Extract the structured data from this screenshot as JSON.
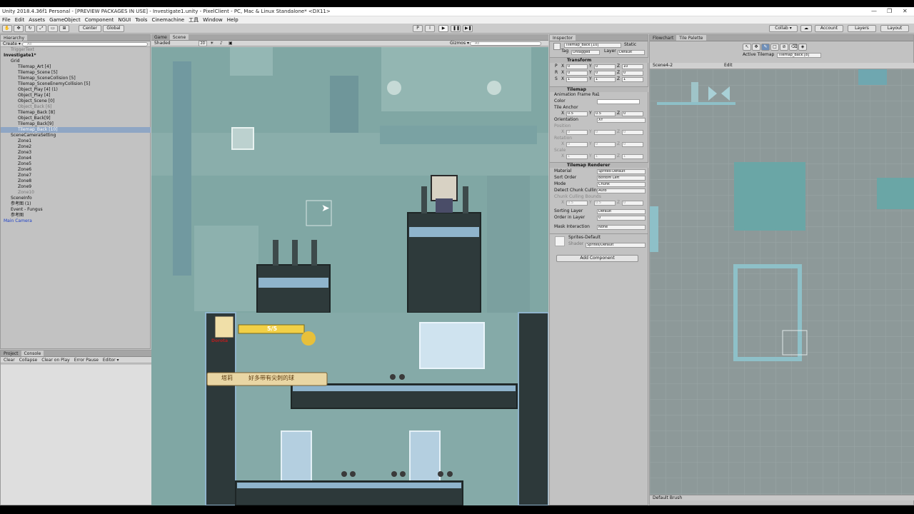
{
  "window": {
    "title": "Unity 2018.4.36f1 Personal - [PREVIEW PACKAGES IN USE] - Investigate1.unity - PixelClient - PC, Mac & Linux Standalone* <DX11>",
    "controls": [
      "—",
      "❐",
      "✕"
    ]
  },
  "menu": [
    "File",
    "Edit",
    "Assets",
    "GameObject",
    "Component",
    "NGUI",
    "Tools",
    "Cinemachine",
    "工具",
    "Window",
    "Help"
  ],
  "toolbar": {
    "pivot": "Center",
    "space": "Global",
    "collab": "Collab ▾",
    "account": "Account",
    "layers": "Layers",
    "layout": "Layout"
  },
  "hierarchy": {
    "tab": "Hierarchy",
    "create": "Create ▾",
    "search_placeholder": "All",
    "rows": [
      {
        "label": "TriggerText",
        "indent": 1,
        "dim": true
      },
      {
        "label": "Investigate1*",
        "indent": 0,
        "bold": true
      },
      {
        "label": "Grid",
        "indent": 1
      },
      {
        "label": "Tilemap_Art [4]",
        "indent": 2
      },
      {
        "label": "Tilemap_Scene [5]",
        "indent": 2
      },
      {
        "label": "Tilemap_SceneCollision [5]",
        "indent": 2
      },
      {
        "label": "Tilemap_SceneEnemyCollision [5]",
        "indent": 2
      },
      {
        "label": "Object_Play [4] (1)",
        "indent": 2
      },
      {
        "label": "Object_Play [4]",
        "indent": 2
      },
      {
        "label": "Object_Scene [0]",
        "indent": 2
      },
      {
        "label": "Object_Back [6]",
        "indent": 2,
        "dim": true
      },
      {
        "label": "Tilemap_Back [8]",
        "indent": 2
      },
      {
        "label": "Object_Back[9]",
        "indent": 2
      },
      {
        "label": "Tilemap_Back[9]",
        "indent": 2
      },
      {
        "label": "Tilemap_Back [10]",
        "indent": 2,
        "selected": true
      },
      {
        "label": "SceneCameraSetting",
        "indent": 1
      },
      {
        "label": "Zone1",
        "indent": 2
      },
      {
        "label": "Zone2",
        "indent": 2
      },
      {
        "label": "Zone3",
        "indent": 2
      },
      {
        "label": "Zone4",
        "indent": 2
      },
      {
        "label": "Zone5",
        "indent": 2
      },
      {
        "label": "Zone6",
        "indent": 2
      },
      {
        "label": "Zone7",
        "indent": 2
      },
      {
        "label": "Zone8",
        "indent": 2
      },
      {
        "label": "Zone9",
        "indent": 2
      },
      {
        "label": "Zone10",
        "indent": 2,
        "dim": true
      },
      {
        "label": "SceneInfo",
        "indent": 1
      },
      {
        "label": "参考图 (1)",
        "indent": 1
      },
      {
        "label": "Event - Fungus",
        "indent": 1
      },
      {
        "label": "参考图",
        "indent": 1
      },
      {
        "label": "Main Camera",
        "indent": 0,
        "blue": true
      }
    ]
  },
  "console": {
    "tabs": [
      "Project",
      "Console"
    ],
    "buttons": [
      "Clear",
      "Collapse",
      "Clear on Play",
      "Error Pause",
      "Editor ▾"
    ]
  },
  "scene": {
    "tabs": [
      "Game",
      "Scene"
    ],
    "shading": "Shaded",
    "mode2d": "2D",
    "gizmos": "Gizmos ▾",
    "search_placeholder": "All"
  },
  "game_hud": {
    "hp": "5/5",
    "name_tag": "Dorota",
    "dialog_speaker": "塔莉",
    "dialog_text": "好多带有尖刺的球"
  },
  "inspector": {
    "tab": "Inspector",
    "object_name": "Tilemap_Back [10]",
    "static_label": "Static",
    "tag_label": "Tag",
    "tag_value": "Untagged",
    "layer_label": "Layer",
    "layer_value": "Default",
    "transform": {
      "title": "Transform",
      "rows": [
        {
          "label": "P",
          "x": "0",
          "y": "0",
          "z": "10"
        },
        {
          "label": "R",
          "x": "0",
          "y": "0",
          "z": "0"
        },
        {
          "label": "S",
          "x": "1",
          "y": "1",
          "z": "1"
        }
      ]
    },
    "tilemap": {
      "title": "Tilemap",
      "anim_label": "Animation Frame Ra",
      "anim_value": "1",
      "color_label": "Color",
      "anchor_label": "Tile Anchor",
      "anchor": {
        "x": "0.5",
        "y": "0.5",
        "z": "0"
      },
      "orientation_label": "Orientation",
      "orientation_value": "XY",
      "position_label": "Position",
      "rotation_label": "Rotation",
      "scale_label": "Scale",
      "pos": {
        "x": "0",
        "y": "0",
        "z": "0"
      },
      "rot": {
        "x": "0",
        "y": "0",
        "z": "0"
      },
      "scl": {
        "x": "1",
        "y": "1",
        "z": "1"
      }
    },
    "renderer": {
      "title": "Tilemap Renderer",
      "rows": [
        {
          "label": "Material",
          "value": "Sprites-Default"
        },
        {
          "label": "Sort Order",
          "value": "Bottom Left"
        },
        {
          "label": "Mode",
          "value": "Chunk"
        },
        {
          "label": "Detect Chunk Cullin",
          "value": "Auto"
        }
      ],
      "bounds_label": "Chunk Culling Bounds",
      "bounds": {
        "x": "0.5",
        "y": "0.5",
        "z": "0"
      },
      "sorting_layer_label": "Sorting Layer",
      "sorting_layer_value": "Default",
      "order_label": "Order in Layer",
      "order_value": "0",
      "mask_label": "Mask Interaction",
      "mask_value": "None"
    },
    "material": {
      "name": "Sprites-Default",
      "shader_label": "Shader",
      "shader_value": "Sprites/Default"
    },
    "add_component": "Add Component"
  },
  "palette": {
    "tabs": [
      "Flowchart",
      "Tile Palette"
    ],
    "active_label": "Active Tilemap",
    "active_value": "Tilemap_Back [8]",
    "palette_name": "Scene4-2",
    "edit_label": "Edit",
    "brush": "Default Brush"
  }
}
